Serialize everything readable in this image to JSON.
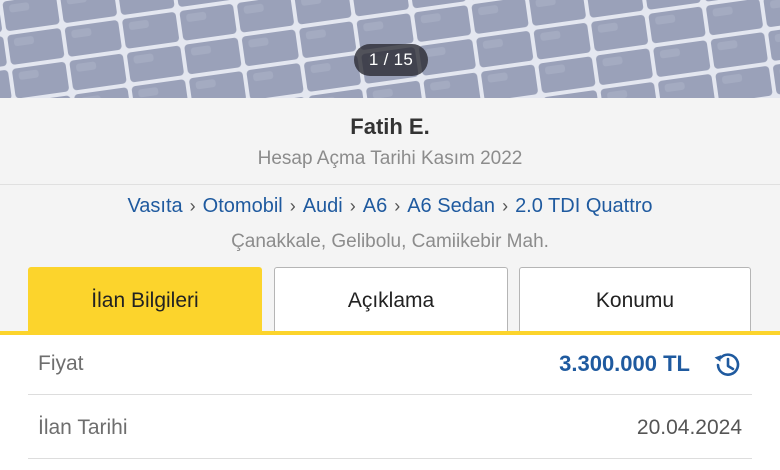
{
  "gallery": {
    "counter": "1 / 15"
  },
  "seller": {
    "name": "Fatih E.",
    "joined": "Hesap Açma Tarihi Kasım 2022"
  },
  "breadcrumb": [
    "Vasıta",
    "Otomobil",
    "Audi",
    "A6",
    "A6 Sedan",
    "2.0 TDI Quattro"
  ],
  "location": "Çanakkale, Gelibolu, Camiikebir Mah.",
  "tabs": [
    {
      "label": "İlan Bilgileri",
      "active": true
    },
    {
      "label": "Açıklama",
      "active": false
    },
    {
      "label": "Konumu",
      "active": false
    }
  ],
  "details": {
    "price": {
      "label": "Fiyat",
      "value": "3.300.000 TL",
      "icon": "price-history-icon"
    },
    "date": {
      "label": "İlan Tarihi",
      "value": "20.04.2024"
    }
  },
  "colors": {
    "accent": "#fcd42c",
    "link": "#1f5a9f",
    "price": "#1f5a9f"
  }
}
